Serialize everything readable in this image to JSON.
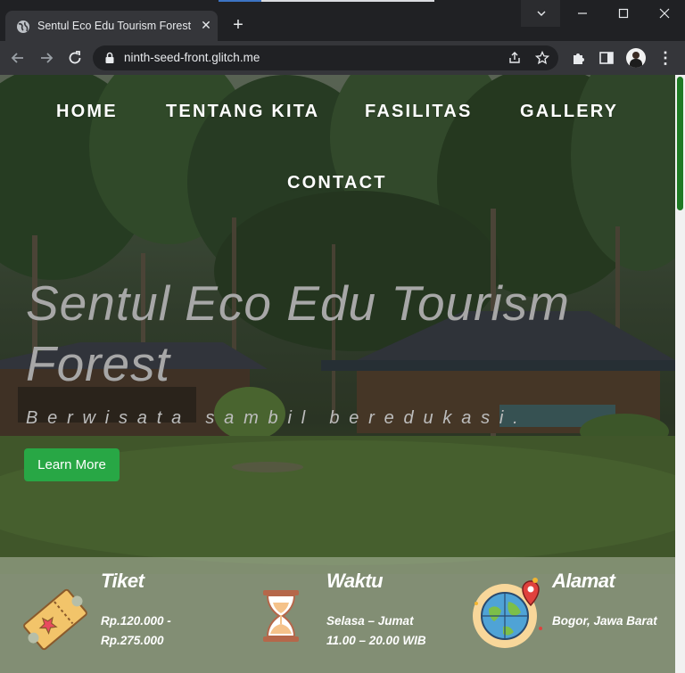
{
  "browser": {
    "tab_title": "Sentul Eco Edu Tourism Forest",
    "url": "ninth-seed-front.glitch.me"
  },
  "nav": {
    "home": "HOME",
    "about": "TENTANG KITA",
    "facilities": "FASILITAS",
    "gallery": "GALLERY",
    "contact": "CONTACT"
  },
  "hero": {
    "title": "Sentul Eco Edu Tourism Forest",
    "subtitle": "Berwisata sambil beredukasi.",
    "button": "Learn More"
  },
  "info": {
    "ticket": {
      "title": "Tiket",
      "line1": "Rp.120.000 -",
      "line2": "Rp.275.000"
    },
    "time": {
      "title": "Waktu",
      "line1": "Selasa – Jumat",
      "line2": "11.00 – 20.00 WIB"
    },
    "address": {
      "title": "Alamat",
      "line1": "Bogor, Jawa Barat"
    }
  },
  "colors": {
    "accent_button": "#28a745",
    "scrollbar_thumb": "#1f7a25",
    "browser_frame": "#202124"
  }
}
